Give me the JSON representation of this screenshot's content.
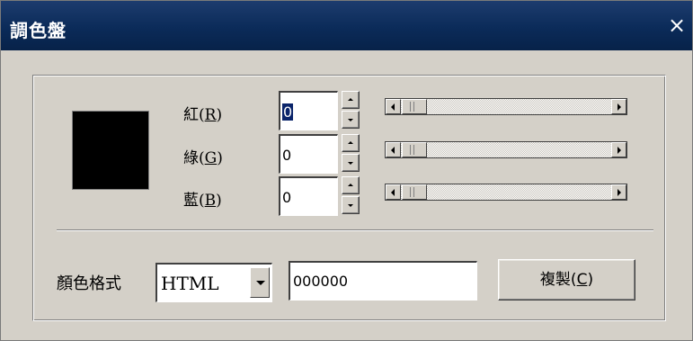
{
  "window": {
    "title": "調色盤",
    "close_glyph": "×"
  },
  "preview": {
    "color": "#000000"
  },
  "channels": [
    {
      "name": "紅",
      "mnemonic": "R",
      "value": "0"
    },
    {
      "name": "綠",
      "mnemonic": "G",
      "value": "0"
    },
    {
      "name": "藍",
      "mnemonic": "B",
      "value": "0"
    }
  ],
  "format": {
    "label": "顏色格式",
    "selected": "HTML",
    "value": "000000"
  },
  "copy_button": {
    "label": "複製",
    "mnemonic": "C"
  },
  "colors": {
    "titlebar": "#0b2b59",
    "face": "#d4d0c8",
    "selection": "#0a246a"
  },
  "icons": {
    "close": "close-icon",
    "spin_up": "arrow-up-icon",
    "spin_down": "arrow-down-icon",
    "scroll_left": "arrow-left-icon",
    "scroll_right": "arrow-right-icon",
    "dropdown": "chevron-down-icon"
  }
}
